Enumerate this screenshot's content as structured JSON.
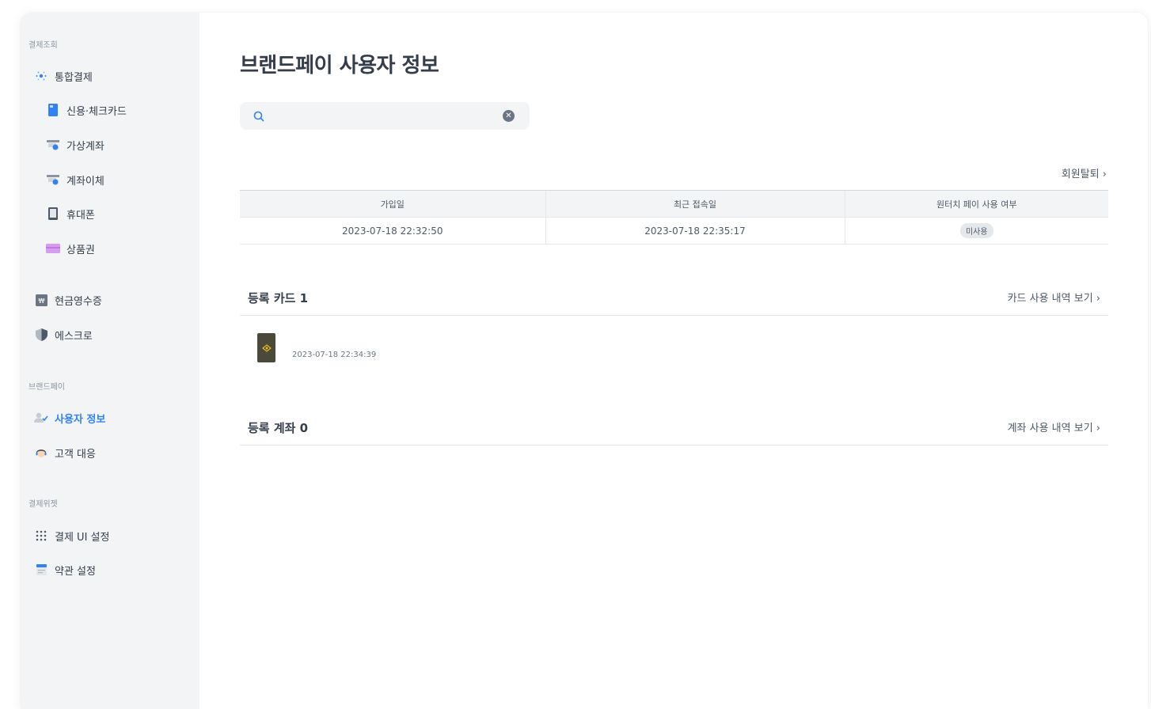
{
  "sidebar": {
    "section_payment": "결제조회",
    "section_brandpay": "브랜드페이",
    "section_widget": "결제위젯",
    "items": {
      "integrated": "통합결제",
      "card": "신용·체크카드",
      "virtual_account": "가상계좌",
      "transfer": "계좌이체",
      "phone": "휴대폰",
      "gift": "상품권",
      "cash_receipt": "현금영수증",
      "escrow": "에스크로",
      "user_info": "사용자 정보",
      "customer_support": "고객 대응",
      "payment_ui": "결제 UI 설정",
      "terms": "약관 설정"
    }
  },
  "page": {
    "title": "브랜드페이 사용자 정보",
    "search_value": "",
    "withdraw_link": "회원탈퇴 ›"
  },
  "info_table": {
    "headers": [
      "가입일",
      "최근 접속일",
      "원터치 페이 사용 여부"
    ],
    "row": [
      "2023-07-18 22:32:50",
      "2023-07-18 22:35:17",
      "미사용"
    ]
  },
  "cards": {
    "title": "등록 카드 1",
    "link": "카드 사용 내역 보기 ›",
    "items": [
      {
        "date": "2023-07-18 22:34:39"
      }
    ]
  },
  "accounts": {
    "title": "등록 계좌 0",
    "link": "계좌 사용 내역 보기 ›"
  },
  "colors": {
    "accent": "#3182f6",
    "sidebar_bg": "#f2f4f6",
    "text": "#333d4b"
  }
}
